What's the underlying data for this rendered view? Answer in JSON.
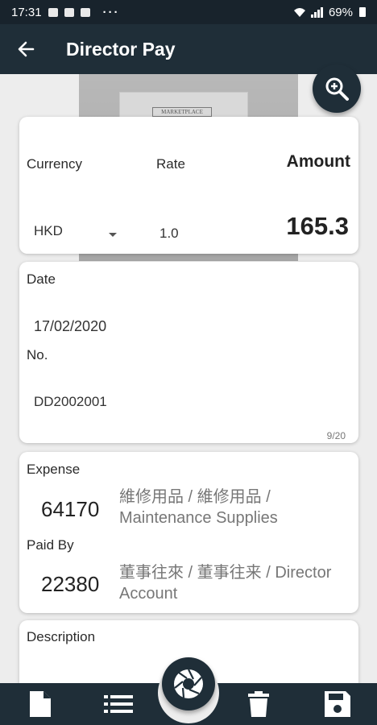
{
  "status_bar": {
    "time": "17:31",
    "more": "···",
    "battery": "69%"
  },
  "app_bar": {
    "title": "Director Pay"
  },
  "amount_card": {
    "currency_label": "Currency",
    "rate_label": "Rate",
    "amount_label": "Amount",
    "currency_value": "HKD",
    "rate_value": "1.0",
    "amount_value": "165.3"
  },
  "date_card": {
    "date_label": "Date",
    "date_value": "17/02/2020",
    "no_label": "No.",
    "no_value": "DD2002001",
    "counter": "9/20"
  },
  "account_card": {
    "expense_label": "Expense",
    "expense_code": "64170",
    "expense_desc": "維修用品 / 維修用品 / Maintenance Supplies",
    "paid_by_label": "Paid By",
    "paid_by_code": "22380",
    "paid_by_desc": "董事往來 / 董事往来 / Director Account"
  },
  "description_card": {
    "label": "Description"
  },
  "receipt": {
    "logo_text": "MARKETPLACE"
  }
}
